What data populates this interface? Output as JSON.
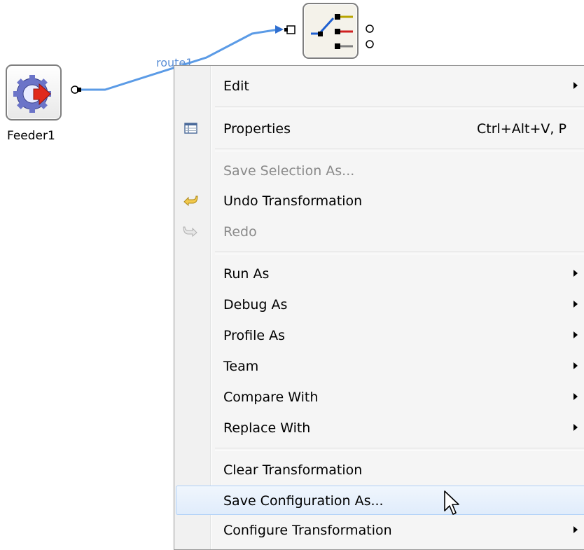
{
  "canvas": {
    "feeder_label": "Feeder1",
    "route_label": "route1"
  },
  "menu": {
    "items": [
      {
        "label": "Edit",
        "submenu": true
      },
      {
        "label": "Properties",
        "shortcut": "Ctrl+Alt+V, P",
        "icon": "properties-table-icon"
      },
      {
        "label": "Save Selection As...",
        "disabled": true
      },
      {
        "label": "Undo Transformation",
        "icon": "undo-arrow-icon"
      },
      {
        "label": "Redo",
        "disabled": true,
        "icon": "redo-arrow-icon"
      },
      {
        "label": "Run As",
        "submenu": true
      },
      {
        "label": "Debug As",
        "submenu": true
      },
      {
        "label": "Profile As",
        "submenu": true
      },
      {
        "label": "Team",
        "submenu": true
      },
      {
        "label": "Compare With",
        "submenu": true
      },
      {
        "label": "Replace With",
        "submenu": true
      },
      {
        "label": "Clear Transformation"
      },
      {
        "label": "Save Configuration As...",
        "highlighted": true
      },
      {
        "label": "Configure Transformation",
        "submenu": true
      }
    ]
  },
  "colors": {
    "route_line": "#5b9be6",
    "menu_highlight_border": "#aecff7",
    "disabled_text": "#8a8a8a"
  }
}
